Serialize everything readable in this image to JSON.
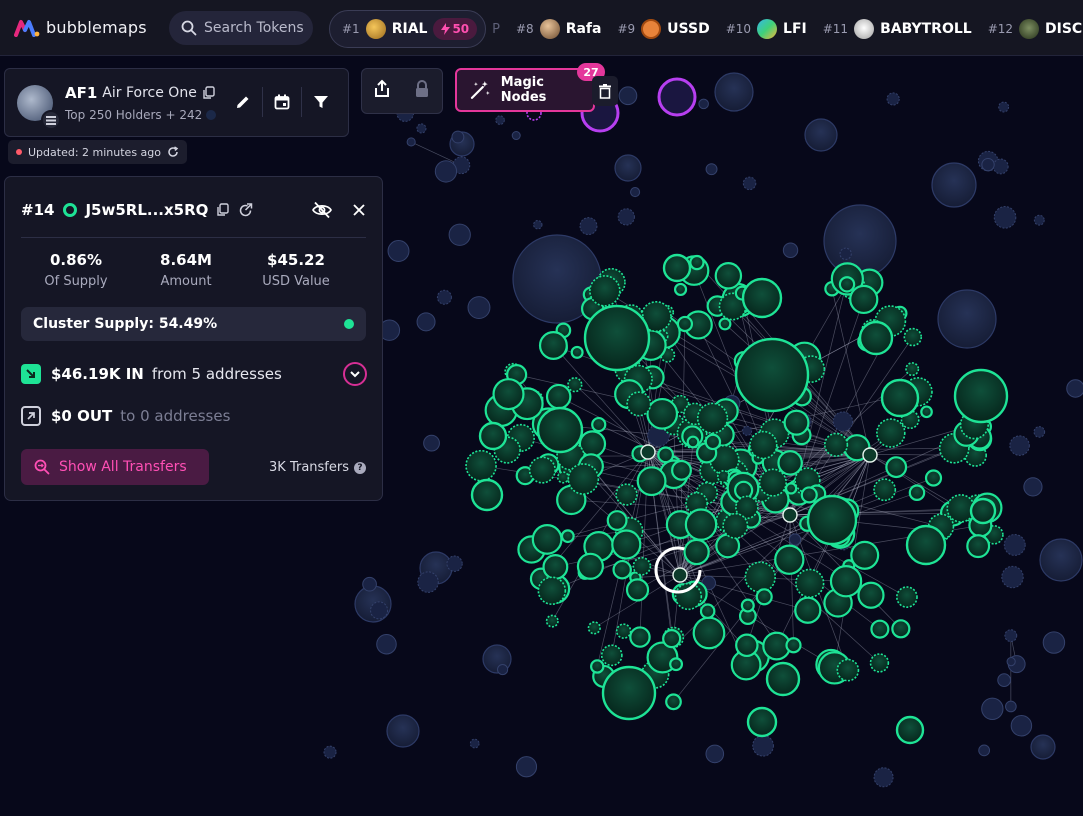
{
  "app": {
    "name": "bubblemaps"
  },
  "search": {
    "label": "Search Tokens"
  },
  "ticker": [
    {
      "rank": "#1",
      "name": "RIAL",
      "badge": "50",
      "icon_color": "#d9a441"
    },
    {
      "rank": "#8",
      "name": "Rafa",
      "icon_color": "#b8865a"
    },
    {
      "rank": "#9",
      "name": "USSD",
      "icon_color": "#e8833a"
    },
    {
      "rank": "#10",
      "name": "LFI",
      "icon_color": "#3cc1a4"
    },
    {
      "rank": "#11",
      "name": "BABYTROLL",
      "icon_color": "#e6e6e6"
    },
    {
      "rank": "#12",
      "name": "DISC",
      "icon_color": "#4a5a3c"
    }
  ],
  "ticker_fragment": "P",
  "token": {
    "symbol": "AF1",
    "name": "Air Force One",
    "subtitle": "Top 250 Holders + 242"
  },
  "updated": {
    "label": "Updated: 2 minutes ago"
  },
  "magic_nodes": {
    "label": "Magic Nodes",
    "count": "27"
  },
  "panel": {
    "rank": "#14",
    "address": "J5w5RL...x5RQ",
    "stats": [
      {
        "value": "0.86%",
        "label": "Of Supply"
      },
      {
        "value": "8.64M",
        "label": "Amount"
      },
      {
        "value": "$45.22",
        "label": "USD Value"
      }
    ],
    "cluster_supply": "Cluster Supply: 54.49%",
    "in": {
      "amount": "$46.19K IN",
      "source": "from 5 addresses"
    },
    "out": {
      "amount": "$0 OUT",
      "source": "to 0 addresses"
    },
    "show_all_label": "Show All Transfers",
    "transfers_count": "3K Transfers"
  },
  "colors": {
    "accent_pink": "#e4379b",
    "cluster_green": "#1ee396",
    "node_blue": "#1c2440",
    "magic_purple": "#b73ff0"
  }
}
